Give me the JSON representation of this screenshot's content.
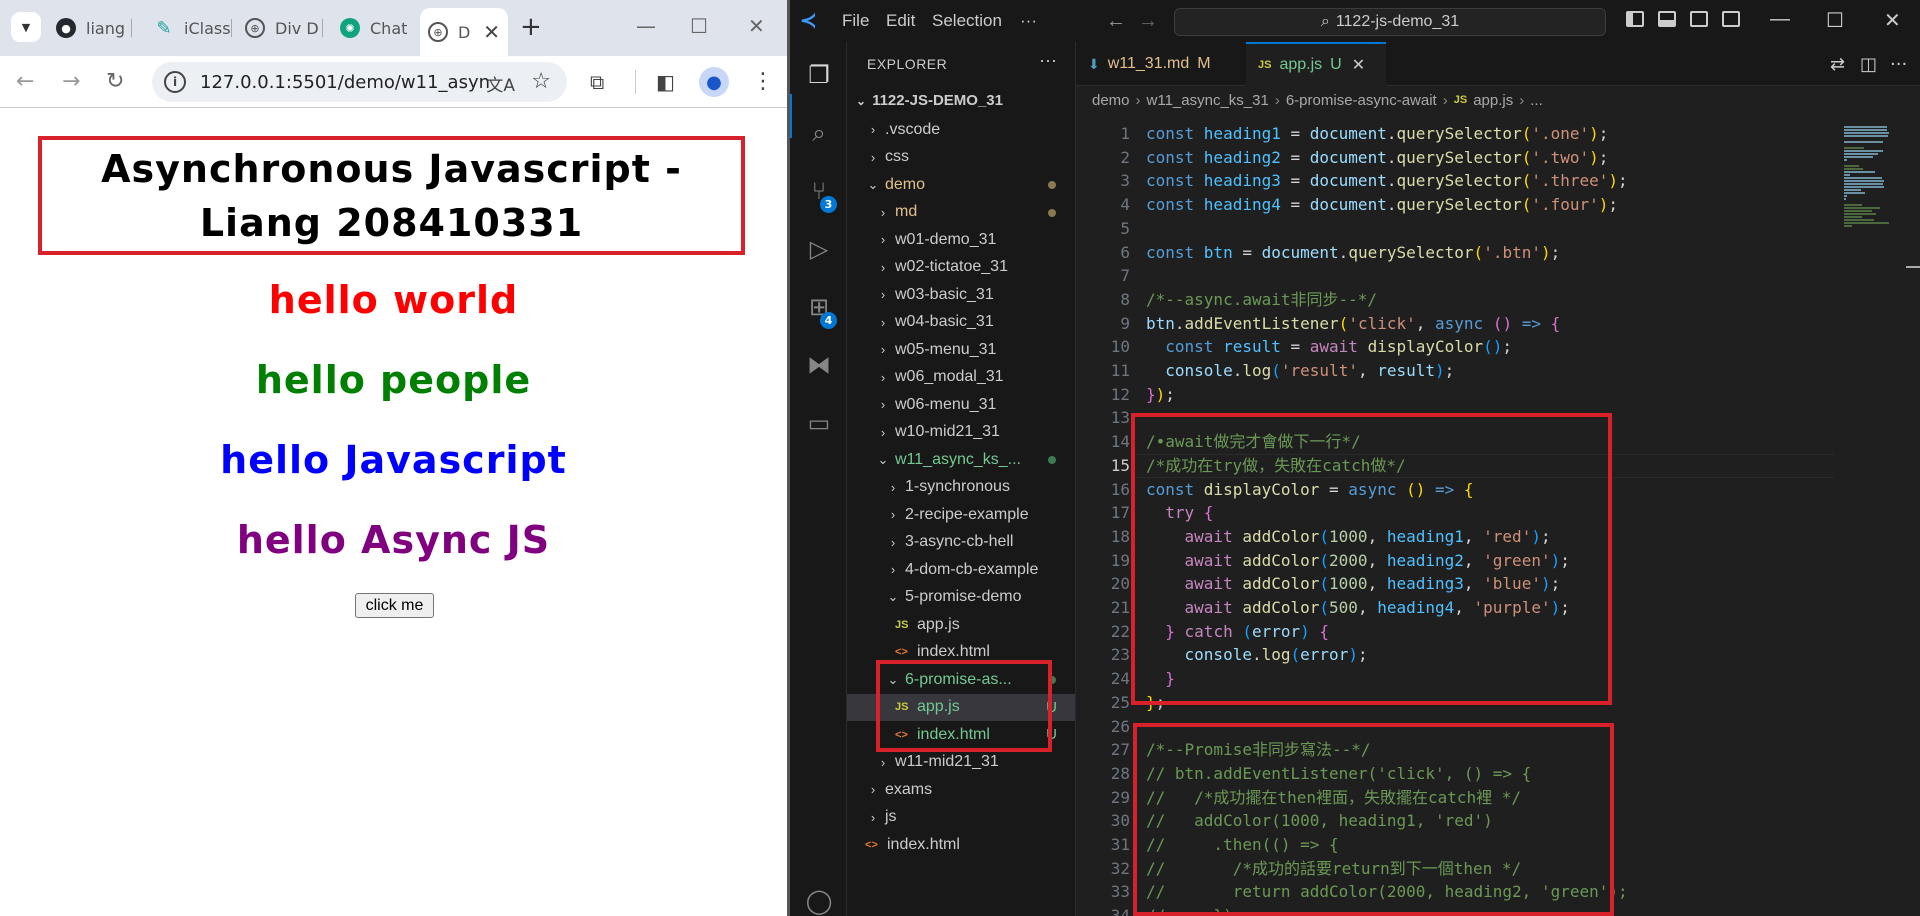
{
  "browser": {
    "tabs": [
      {
        "label": "liang",
        "icon": "github-icon"
      },
      {
        "label": "iClass",
        "icon": "iclass-icon"
      },
      {
        "label": "Div D",
        "icon": "globe-icon"
      },
      {
        "label": "Chat",
        "icon": "chatgpt-icon"
      },
      {
        "label": "D",
        "icon": "globe-icon"
      }
    ],
    "url": "127.0.0.1:5501/demo/w11_async..."
  },
  "page": {
    "title": "Asynchronous Javascript - Liang 208410331",
    "headings": [
      {
        "text": "hello world",
        "color": "#ff0000"
      },
      {
        "text": "hello people",
        "color": "#008000"
      },
      {
        "text": "hello Javascript",
        "color": "#0000ff"
      },
      {
        "text": "hello Async JS",
        "color": "#800080"
      }
    ],
    "button_label": "click me"
  },
  "vscode": {
    "menu": [
      "File",
      "Edit",
      "Selection",
      "···"
    ],
    "search": "1122-js-demo_31",
    "explorer_title": "EXPLORER",
    "root": "1122-JS-DEMO_31",
    "tree": [
      {
        "label": ".vscode",
        "kind": "folder",
        "depth": 1,
        "open": false
      },
      {
        "label": "css",
        "kind": "folder",
        "depth": 1,
        "open": false
      },
      {
        "label": "demo",
        "kind": "folder",
        "depth": 1,
        "open": true,
        "color": "#e2c08d",
        "dot": "#8a7a50"
      },
      {
        "label": "md",
        "kind": "folder",
        "depth": 2,
        "open": false,
        "color": "#e2c08d",
        "dot": "#8a7a50"
      },
      {
        "label": "w01-demo_31",
        "kind": "folder",
        "depth": 2,
        "open": false
      },
      {
        "label": "w02-tictatoe_31",
        "kind": "folder",
        "depth": 2,
        "open": false
      },
      {
        "label": "w03-basic_31",
        "kind": "folder",
        "depth": 2,
        "open": false
      },
      {
        "label": "w04-basic_31",
        "kind": "folder",
        "depth": 2,
        "open": false
      },
      {
        "label": "w05-menu_31",
        "kind": "folder",
        "depth": 2,
        "open": false
      },
      {
        "label": "w06_modal_31",
        "kind": "folder",
        "depth": 2,
        "open": false
      },
      {
        "label": "w06-menu_31",
        "kind": "folder",
        "depth": 2,
        "open": false
      },
      {
        "label": "w10-mid21_31",
        "kind": "folder",
        "depth": 2,
        "open": false
      },
      {
        "label": "w11_async_ks_...",
        "kind": "folder",
        "depth": 2,
        "open": true,
        "color": "#73c991",
        "dot": "#3f7a54"
      },
      {
        "label": "1-synchronous",
        "kind": "folder",
        "depth": 3,
        "open": false
      },
      {
        "label": "2-recipe-example",
        "kind": "folder",
        "depth": 3,
        "open": false
      },
      {
        "label": "3-async-cb-hell",
        "kind": "folder",
        "depth": 3,
        "open": false
      },
      {
        "label": "4-dom-cb-example",
        "kind": "folder",
        "depth": 3,
        "open": false
      },
      {
        "label": "5-promise-demo",
        "kind": "folder",
        "depth": 3,
        "open": true
      },
      {
        "label": "app.js",
        "kind": "js",
        "depth": 4
      },
      {
        "label": "index.html",
        "kind": "html",
        "depth": 4
      },
      {
        "label": "6-promise-as...",
        "kind": "folder",
        "depth": 3,
        "open": true,
        "color": "#73c991",
        "dot": "#3f7a54"
      },
      {
        "label": "app.js",
        "kind": "js",
        "depth": 4,
        "color": "#73c991",
        "status": "U",
        "selected": true
      },
      {
        "label": "index.html",
        "kind": "html",
        "depth": 4,
        "color": "#73c991",
        "status": "U"
      },
      {
        "label": "w11-mid21_31",
        "kind": "folder",
        "depth": 2,
        "open": false
      },
      {
        "label": "exams",
        "kind": "folder",
        "depth": 1,
        "open": false
      },
      {
        "label": "js",
        "kind": "folder",
        "depth": 1,
        "open": false
      },
      {
        "label": "index.html",
        "kind": "html",
        "depth": 1
      }
    ],
    "tabs": [
      {
        "label": "w11_31.md",
        "mod": "M",
        "icon": "markdown-icon",
        "color": "#e2c08d"
      },
      {
        "label": "app.js",
        "mod": "U",
        "icon": "js-icon",
        "color": "#73c991",
        "active": true
      }
    ],
    "breadcrumb": [
      "demo",
      "w11_async_ks_31",
      "6-promise-async-await",
      "app.js",
      "..."
    ],
    "badges": {
      "scm": "3",
      "extensions": "4"
    },
    "code": [
      [
        [
          "const ",
          "k"
        ],
        [
          "heading1",
          "v"
        ],
        [
          " = ",
          "o"
        ],
        [
          "document",
          "vv"
        ],
        [
          ".",
          "o"
        ],
        [
          "querySelector",
          "f"
        ],
        [
          "(",
          "b1"
        ],
        [
          "'.one'",
          "s"
        ],
        [
          ")",
          "b1"
        ],
        [
          ";",
          "o"
        ]
      ],
      [
        [
          "const ",
          "k"
        ],
        [
          "heading2",
          "v"
        ],
        [
          " = ",
          "o"
        ],
        [
          "document",
          "vv"
        ],
        [
          ".",
          "o"
        ],
        [
          "querySelector",
          "f"
        ],
        [
          "(",
          "b1"
        ],
        [
          "'.two'",
          "s"
        ],
        [
          ")",
          "b1"
        ],
        [
          ";",
          "o"
        ]
      ],
      [
        [
          "const ",
          "k"
        ],
        [
          "heading3",
          "v"
        ],
        [
          " = ",
          "o"
        ],
        [
          "document",
          "vv"
        ],
        [
          ".",
          "o"
        ],
        [
          "querySelector",
          "f"
        ],
        [
          "(",
          "b1"
        ],
        [
          "'.three'",
          "s"
        ],
        [
          ")",
          "b1"
        ],
        [
          ";",
          "o"
        ]
      ],
      [
        [
          "const ",
          "k"
        ],
        [
          "heading4",
          "v"
        ],
        [
          " = ",
          "o"
        ],
        [
          "document",
          "vv"
        ],
        [
          ".",
          "o"
        ],
        [
          "querySelector",
          "f"
        ],
        [
          "(",
          "b1"
        ],
        [
          "'.four'",
          "s"
        ],
        [
          ")",
          "b1"
        ],
        [
          ";",
          "o"
        ]
      ],
      [],
      [
        [
          "const ",
          "k"
        ],
        [
          "btn",
          "v"
        ],
        [
          " = ",
          "o"
        ],
        [
          "document",
          "vv"
        ],
        [
          ".",
          "o"
        ],
        [
          "querySelector",
          "f"
        ],
        [
          "(",
          "b1"
        ],
        [
          "'.btn'",
          "s"
        ],
        [
          ")",
          "b1"
        ],
        [
          ";",
          "o"
        ]
      ],
      [],
      [
        [
          "/*--async.await非同步--*/",
          "c"
        ]
      ],
      [
        [
          "btn",
          "vv"
        ],
        [
          ".",
          "o"
        ],
        [
          "addEventListener",
          "f"
        ],
        [
          "(",
          "b1"
        ],
        [
          "'click'",
          "s"
        ],
        [
          ", ",
          "o"
        ],
        [
          "async ",
          "k"
        ],
        [
          "()",
          "b2"
        ],
        [
          " => ",
          "k"
        ],
        [
          "{",
          "b2"
        ]
      ],
      [
        [
          "  const ",
          "k"
        ],
        [
          "result",
          "v"
        ],
        [
          " = ",
          "o"
        ],
        [
          "await ",
          "kc"
        ],
        [
          "displayColor",
          "f"
        ],
        [
          "()",
          "b3"
        ],
        [
          ";",
          "o"
        ]
      ],
      [
        [
          "  console",
          "vv"
        ],
        [
          ".",
          "o"
        ],
        [
          "log",
          "f"
        ],
        [
          "(",
          "b3"
        ],
        [
          "'result'",
          "s"
        ],
        [
          ", ",
          "o"
        ],
        [
          "result",
          "vv"
        ],
        [
          ")",
          "b3"
        ],
        [
          ";",
          "o"
        ]
      ],
      [
        [
          "}",
          "b2"
        ],
        [
          ")",
          "b1"
        ],
        [
          ";",
          "o"
        ]
      ],
      [],
      [
        [
          "/•await做完才會做下一行*/",
          "c"
        ]
      ],
      [
        [
          "/*成功在try做，失敗在catch做*/",
          "c"
        ]
      ],
      [
        [
          "const ",
          "k"
        ],
        [
          "displayColor",
          "f"
        ],
        [
          " = ",
          "o"
        ],
        [
          "async ",
          "k"
        ],
        [
          "()",
          "b1"
        ],
        [
          " => ",
          "k"
        ],
        [
          "{",
          "b1"
        ]
      ],
      [
        [
          "  try ",
          "kc"
        ],
        [
          "{",
          "b2"
        ]
      ],
      [
        [
          "    await ",
          "kc"
        ],
        [
          "addColor",
          "f"
        ],
        [
          "(",
          "b3"
        ],
        [
          "1000",
          "n"
        ],
        [
          ", ",
          "o"
        ],
        [
          "heading1",
          "v"
        ],
        [
          ", ",
          "o"
        ],
        [
          "'red'",
          "s"
        ],
        [
          ")",
          "b3"
        ],
        [
          ";",
          "o"
        ]
      ],
      [
        [
          "    await ",
          "kc"
        ],
        [
          "addColor",
          "f"
        ],
        [
          "(",
          "b3"
        ],
        [
          "2000",
          "n"
        ],
        [
          ", ",
          "o"
        ],
        [
          "heading2",
          "v"
        ],
        [
          ", ",
          "o"
        ],
        [
          "'green'",
          "s"
        ],
        [
          ")",
          "b3"
        ],
        [
          ";",
          "o"
        ]
      ],
      [
        [
          "    await ",
          "kc"
        ],
        [
          "addColor",
          "f"
        ],
        [
          "(",
          "b3"
        ],
        [
          "1000",
          "n"
        ],
        [
          ", ",
          "o"
        ],
        [
          "heading3",
          "v"
        ],
        [
          ", ",
          "o"
        ],
        [
          "'blue'",
          "s"
        ],
        [
          ")",
          "b3"
        ],
        [
          ";",
          "o"
        ]
      ],
      [
        [
          "    await ",
          "kc"
        ],
        [
          "addColor",
          "f"
        ],
        [
          "(",
          "b3"
        ],
        [
          "500",
          "n"
        ],
        [
          ", ",
          "o"
        ],
        [
          "heading4",
          "v"
        ],
        [
          ", ",
          "o"
        ],
        [
          "'purple'",
          "s"
        ],
        [
          ")",
          "b3"
        ],
        [
          ";",
          "o"
        ]
      ],
      [
        [
          "  }",
          "b2"
        ],
        [
          " catch ",
          "kc"
        ],
        [
          "(",
          "b3"
        ],
        [
          "error",
          "vv"
        ],
        [
          ")",
          "b3"
        ],
        [
          " {",
          "b2"
        ]
      ],
      [
        [
          "    console",
          "vv"
        ],
        [
          ".",
          "o"
        ],
        [
          "log",
          "f"
        ],
        [
          "(",
          "b3"
        ],
        [
          "error",
          "vv"
        ],
        [
          ")",
          "b3"
        ],
        [
          ";",
          "o"
        ]
      ],
      [
        [
          "  }",
          "b2"
        ]
      ],
      [
        [
          "}",
          "b1"
        ],
        [
          ";",
          "o"
        ]
      ],
      [],
      [
        [
          "/*--Promise非同步寫法--*/",
          "c"
        ]
      ],
      [
        [
          "// btn.addEventListener('click', () => {",
          "c"
        ]
      ],
      [
        [
          "//   /*成功擺在then裡面，失敗擺在catch裡 */",
          "c"
        ]
      ],
      [
        [
          "//   addColor(1000, heading1, 'red')",
          "c"
        ]
      ],
      [
        [
          "//     .then(() => {",
          "c"
        ]
      ],
      [
        [
          "//       /*成功的話要return到下一個then */",
          "c"
        ]
      ],
      [
        [
          "//       return addColor(2000, heading2, 'green');",
          "c"
        ]
      ],
      [
        [
          "//     })",
          "c"
        ]
      ]
    ],
    "current_line": 15
  }
}
